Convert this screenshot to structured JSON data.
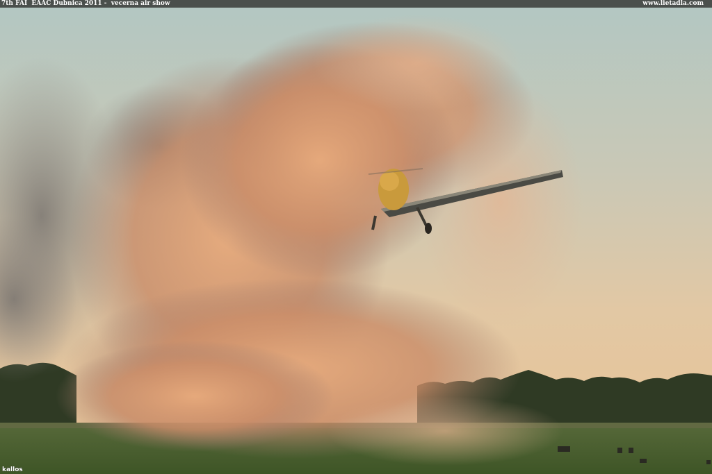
{
  "caption": {
    "title": "7th FAI  EAAC Dubnica 2011 -  vecerna air show",
    "site": "www.lietadla.com"
  },
  "photo": {
    "subject": "aerobatic plane flying low through a large dust cloud at sunset"
  },
  "credit": "kallos"
}
